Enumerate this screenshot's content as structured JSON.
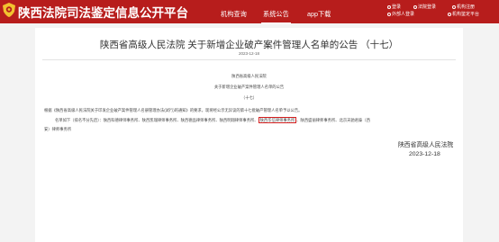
{
  "header": {
    "site_title": "陕西法院司法鉴定信息公开平台",
    "nav": [
      "机构查询",
      "系统公告",
      "app下载"
    ],
    "active_nav": "系统公告",
    "links": {
      "login": "登录",
      "judge_login": "法院登录",
      "org_login": "机构注册",
      "outer_login": "外部人登录",
      "outer_platform": "机构鉴定平台"
    }
  },
  "article": {
    "title": "陕西省高级人民法院 关于新增企业破产案件管理人名单的公告 （十七）",
    "date": "2023-12-18",
    "org_line": "陕西省高级人民法院",
    "subject_line": "关于新增企业破产案件管理人名单的公告",
    "number_line": "（十七）",
    "para1": "根据《陕西省高级人民法院关于印发企业破产案件管理人名册管理办法(试行)的通知》的要求，现将经公示无异议的第十七批破产管理人名单予以公告。",
    "para2_a": "名单如下（排名不分先后）：陕西科德律师事务所、陕西凯瑞律师事务所、陕西德品律师事务所、陕西明翔律师事务所、",
    "para2_highlight": "陕西华信律师事务所",
    "para2_b": "、陕西盛丽律师事务所、北京天驰君泰（西",
    "para2_c": "安）律师事务所",
    "signature": "陕西省高级人民法院",
    "signature_date": "2023-12-18"
  },
  "colors": {
    "brand_red": "#b71d1c",
    "highlight_border": "#d42020"
  }
}
